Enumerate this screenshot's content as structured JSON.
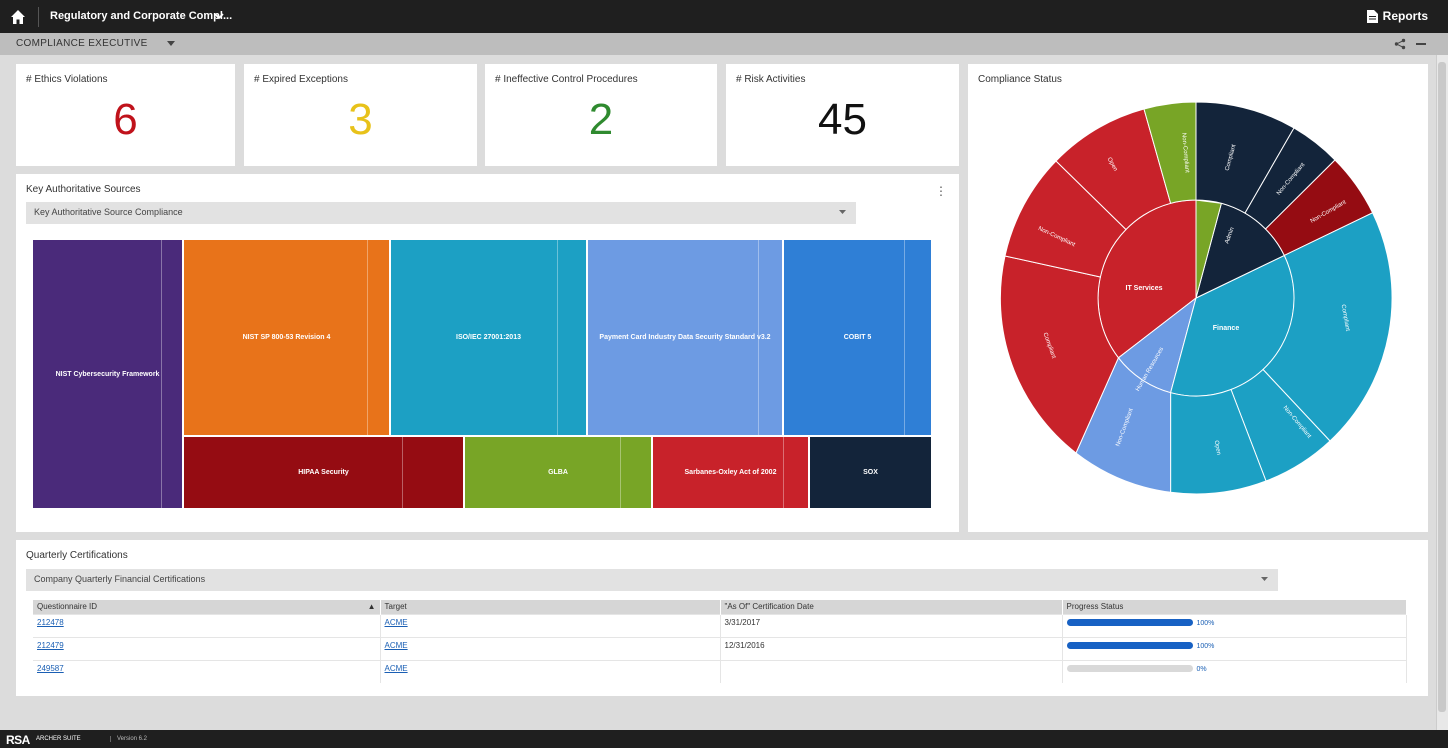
{
  "topbar": {
    "app_title": "Regulatory and Corporate Compl...",
    "reports_label": "Reports"
  },
  "subbar": {
    "title": "COMPLIANCE EXECUTIVE"
  },
  "kpis": [
    {
      "label": "# Ethics Violations",
      "value": "6",
      "color": "#c0121b"
    },
    {
      "label": "# Expired Exceptions",
      "value": "3",
      "color": "#e8c21a"
    },
    {
      "label": "# Ineffective Control Procedures",
      "value": "2",
      "color": "#2f8a2f"
    },
    {
      "label": "# Risk Activities",
      "value": "45",
      "color": "#111111"
    }
  ],
  "sources": {
    "title": "Key Authoritative Sources",
    "select_value": "Key Authoritative Source Compliance",
    "tiles": [
      {
        "label": "NIST Cybersecurity Framework",
        "color": "#4a2a7a"
      },
      {
        "label": "NIST SP 800-53 Revision 4",
        "color": "#e8731a"
      },
      {
        "label": "ISO/IEC 27001:2013",
        "color": "#1ca0c4"
      },
      {
        "label": "Payment Card Industry Data Security Standard v3.2",
        "color": "#6d9be3"
      },
      {
        "label": "COBIT 5",
        "color": "#2f7fd6"
      },
      {
        "label": "HIPAA Security",
        "color": "#950c12"
      },
      {
        "label": "GLBA",
        "color": "#78a526"
      },
      {
        "label": "Sarbanes-Oxley Act of 2002",
        "color": "#c8222a"
      },
      {
        "label": "SOX",
        "color": "#13243a"
      }
    ]
  },
  "compliance": {
    "title": "Compliance Status",
    "inner_labels": [
      "IT Services",
      "Finance",
      "Human Resources",
      "Admin"
    ],
    "outer_labels": [
      "Compliant",
      "Non-Compliant",
      "Non-Compliant",
      "Compliant",
      "Non-Compliant",
      "Open",
      "Non-Compliant",
      "Compliant",
      "Non-Compliant",
      "Open",
      "Non-Compliant"
    ]
  },
  "certifications": {
    "title": "Quarterly Certifications",
    "select_value": "Company Quarterly Financial Certifications",
    "columns": [
      "Questionnaire ID",
      "Target",
      "\"As Of\" Certification Date",
      "Progress Status"
    ],
    "rows": [
      {
        "id": "212478",
        "target": "ACME",
        "date": "3/31/2017",
        "progress": 100,
        "pct": "100%"
      },
      {
        "id": "212479",
        "target": "ACME",
        "date": "12/31/2016",
        "progress": 100,
        "pct": "100%"
      },
      {
        "id": "249587",
        "target": "ACME",
        "date": "",
        "progress": 0,
        "pct": "0%"
      }
    ]
  },
  "footer": {
    "logo": "RSA",
    "suite": "ARCHER SUITE",
    "version": "Version 6.2"
  }
}
